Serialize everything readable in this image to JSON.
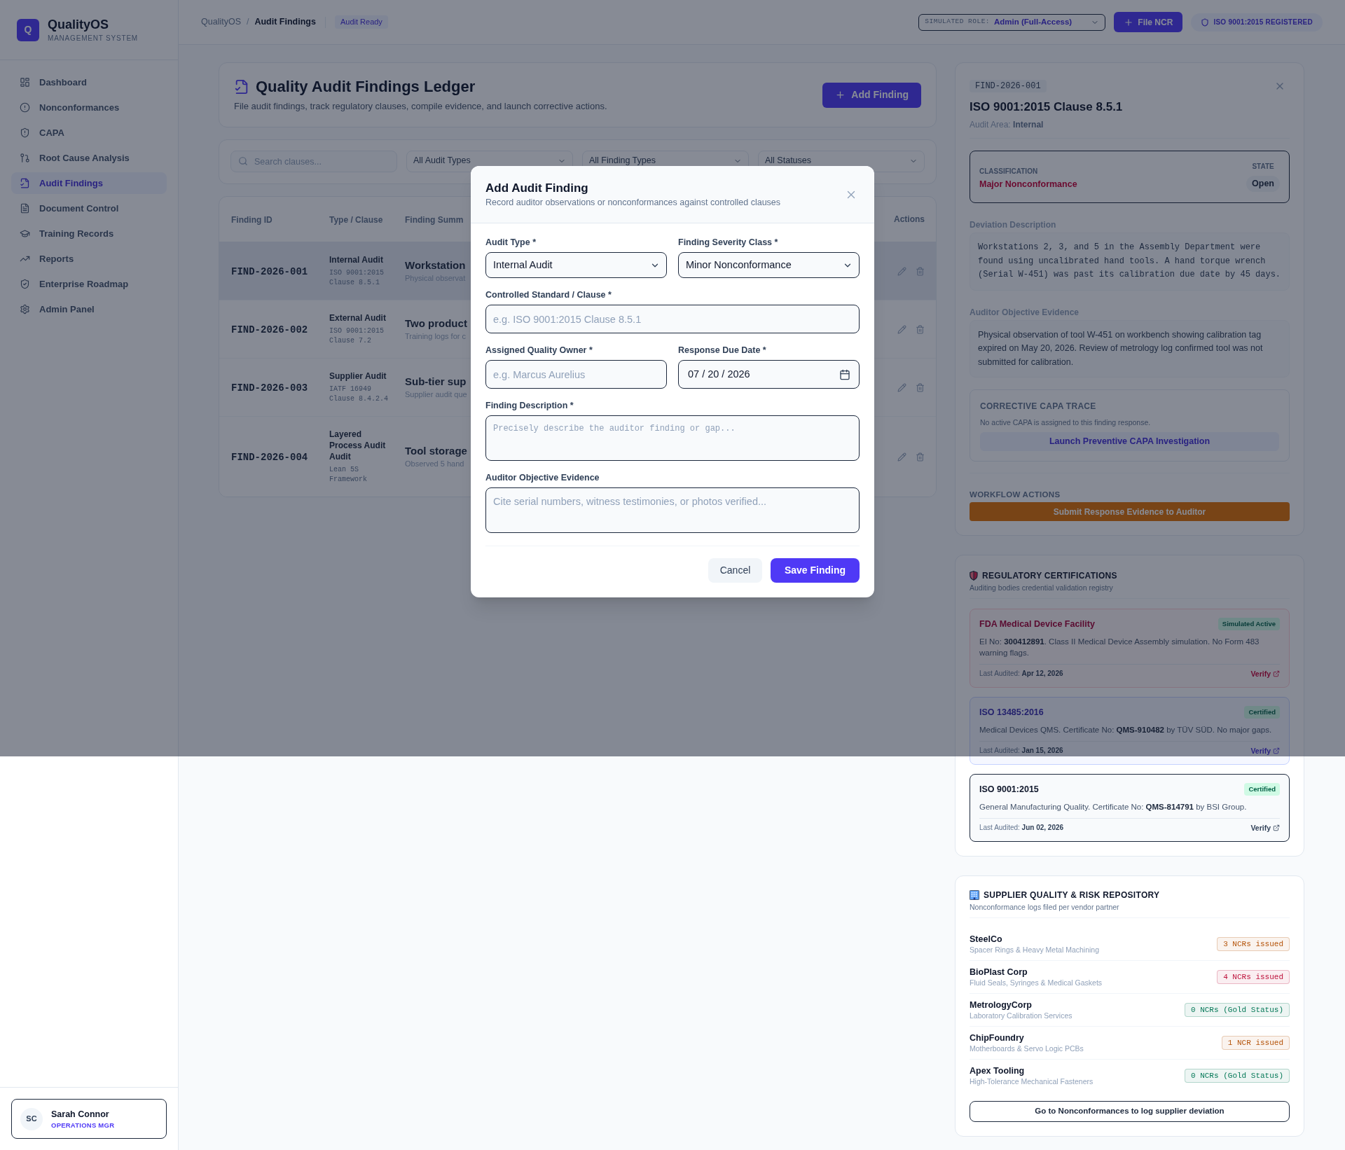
{
  "sidebar": {
    "logo": {
      "mark": "Q",
      "name": "QualityOS",
      "tagline": "MANAGEMENT SYSTEM"
    },
    "items": [
      {
        "label": "Dashboard",
        "selected": false
      },
      {
        "label": "Nonconformances",
        "selected": false
      },
      {
        "label": "CAPA",
        "selected": false
      },
      {
        "label": "Root Cause Analysis",
        "selected": false
      },
      {
        "label": "Audit Findings",
        "selected": true
      },
      {
        "label": "Document Control",
        "selected": false
      },
      {
        "label": "Training Records",
        "selected": false
      },
      {
        "label": "Reports",
        "selected": false
      },
      {
        "label": "Enterprise Roadmap",
        "selected": false
      },
      {
        "label": "Admin Panel",
        "selected": false
      }
    ],
    "user": {
      "initials": "SC",
      "name": "Sarah Connor",
      "role": "OPERATIONS MGR"
    }
  },
  "header": {
    "breadcrumb": [
      {
        "label": "QualityOS",
        "selected": false
      },
      {
        "label": "Audit Findings",
        "selected": true
      }
    ],
    "separator": "/",
    "badge": "Audit Ready",
    "role_select": {
      "label": "SIMULATED ROLE:",
      "value": "Admin (Full-Access)"
    },
    "file_button": "File NCR",
    "registration": "ISO 9001:2015 REGISTERED"
  },
  "ledger": {
    "title": "Quality Audit Findings Ledger",
    "subtitle": "File audit findings, track regulatory clauses, compile evidence, and launch corrective actions.",
    "add_button": "Add Finding"
  },
  "filters": {
    "search": {
      "placeholder": "Search clauses..."
    },
    "selects": [
      "All Audit Types",
      "All Finding Types",
      "All Statuses"
    ]
  },
  "table": {
    "columns": [
      "Finding ID",
      "Type / Clause",
      "Finding Summ",
      "Actions"
    ],
    "rows": [
      {
        "id": "FIND-2026-001",
        "type": "Internal Audit",
        "clause": "ISO 9001:2015 Clause 8.5.1",
        "summary": "Workstation",
        "note": "Physical observat",
        "selected": true
      },
      {
        "id": "FIND-2026-002",
        "type": "External Audit",
        "clause": "ISO 9001:2015 Clause 7.2",
        "summary": "Two product",
        "note": "Training logs for c",
        "selected": false
      },
      {
        "id": "FIND-2026-003",
        "type": "Supplier Audit",
        "clause": "IATF 16949 Clause 8.4.2.4",
        "summary": "Sub-tier sup",
        "note": "Supplier audit que",
        "selected": false
      },
      {
        "id": "FIND-2026-004",
        "type": "Layered Process Audit Audit",
        "clause": "Lean 5S Framework",
        "summary": "Tool storage",
        "note": "Observed 5 hand",
        "selected": false
      }
    ]
  },
  "modal": {
    "title": "Add Audit Finding",
    "subtitle": "Record auditor observations or nonconformances against controlled clauses",
    "fields": [
      {
        "kind": "select",
        "label": "Audit Type *",
        "value": "Internal Audit",
        "wide": false
      },
      {
        "kind": "select",
        "label": "Finding Severity Class *",
        "value": "Minor Nonconformance",
        "wide": false
      },
      {
        "kind": "input",
        "label": "Controlled Standard / Clause *",
        "placeholder": "e.g. ISO 9001:2015 Clause 8.5.1",
        "wide": true
      },
      {
        "kind": "input",
        "label": "Assigned Quality Owner *",
        "placeholder": "e.g. Marcus Aurelius",
        "wide": false
      },
      {
        "kind": "date",
        "label": "Response Due Date *",
        "value": "07 / 20 / 2026",
        "wide": false
      },
      {
        "kind": "textarea",
        "label": "Finding Description *",
        "placeholder": "Precisely describe the auditor finding or gap...",
        "monospace": true,
        "wide": true
      },
      {
        "kind": "textarea",
        "label": "Auditor Objective Evidence",
        "placeholder": "Cite serial numbers, witness testimonies, or photos verified...",
        "monospace": false,
        "wide": true
      }
    ],
    "buttons": [
      {
        "label": "Cancel",
        "kind": "secondary"
      },
      {
        "label": "Save Finding",
        "kind": "primary"
      }
    ]
  },
  "detail": {
    "id": "FIND-2026-001",
    "title": "ISO 9001:2015 Clause 8.5.1",
    "area": "Audit Area: **Internal**",
    "classification": {
      "label": "CLASSIFICATION",
      "value": "Major Nonconformance"
    },
    "state": {
      "label": "STATE",
      "value": "Open"
    },
    "sections": [
      {
        "label": "Deviation Description",
        "text": "Workstations 2, 3, and 5 in the Assembly Department were found using uncalibrated hand tools. A hand torque wrench (Serial W-451) was past its calibration due date by 45 days.",
        "monospace": true
      },
      {
        "label": "Auditor Objective Evidence",
        "text": "Physical observation of tool W-451 on workbench showing calibration tag expired on May 20, 2026. Review of metrology log confirmed tool was not submitted for calibration.",
        "monospace": false
      }
    ],
    "capa": {
      "title": "CORRECTIVE CAPA TRACE",
      "text": "No active CAPA is assigned to this finding response.",
      "button": "Launch Preventive CAPA Investigation"
    },
    "workflow": {
      "label": "WORKFLOW ACTIONS",
      "button": "Submit Response Evidence to Auditor"
    }
  },
  "certifications": {
    "title": "REGULATORY CERTIFICATIONS",
    "subtitle": "Auditing bodies credential validation registry",
    "items": [
      {
        "name": "FDA Medical Device Facility",
        "badge": "Simulated Active",
        "text": "EI No: **300412891**. Class II Medical Device Assembly simulation. No Form 483 warning flags.",
        "audited": "Last Audited: **Apr 12, 2026**",
        "link": "Verify",
        "kind": "fda"
      },
      {
        "name": "ISO 13485:2016",
        "badge": "Certified",
        "text": "Medical Devices QMS. Certificate No: **QMS-910482** by TÜV SÜD. No major gaps.",
        "audited": "Last Audited: **Jan 15, 2026**",
        "link": "Verify",
        "kind": "iso"
      },
      {
        "name": "ISO 9001:2015",
        "badge": "Certified",
        "text": "General Manufacturing Quality. Certificate No: **QMS-814791** by BSI Group.",
        "audited": "Last Audited: **Jun 02, 2026**",
        "link": "Verify",
        "kind": "base"
      }
    ]
  },
  "suppliers": {
    "title": "SUPPLIER QUALITY & RISK REPOSITORY",
    "subtitle": "Nonconformance logs filed per vendor partner",
    "items": [
      {
        "name": "SteelCo",
        "detail": "Spacer Rings & Heavy Metal Machining",
        "badge": "3 NCRs issued",
        "color": "#b45309"
      },
      {
        "name": "BioPlast Corp",
        "detail": "Fluid Seals, Syringes & Medical Gaskets",
        "badge": "4 NCRs issued",
        "color": "#be123c"
      },
      {
        "name": "MetrologyCorp",
        "detail": "Laboratory Calibration Services",
        "badge": "0 NCRs (Gold Status)",
        "color": "#047857"
      },
      {
        "name": "ChipFoundry",
        "detail": "Motherboards & Servo Logic PCBs",
        "badge": "1 NCR issued",
        "color": "#b45309"
      },
      {
        "name": "Apex Tooling",
        "detail": "High-Tolerance Mechanical Fasteners",
        "badge": "0 NCRs (Gold Status)",
        "color": "#047857"
      }
    ],
    "button": "Go to Nonconformances to log supplier deviation"
  }
}
